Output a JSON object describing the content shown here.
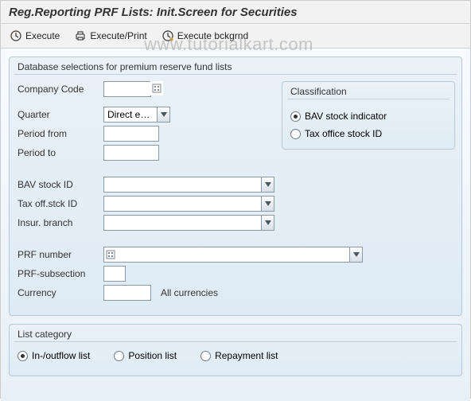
{
  "watermark": "www.tutorialkart.com",
  "header": {
    "title": "Reg.Reporting PRF Lists: Init.Screen for Securities"
  },
  "toolbar": {
    "exec": "Execute",
    "exec_print": "Execute/Print",
    "exec_bg": "Execute bckgrnd"
  },
  "panel1": {
    "title": "Database selections for premium reserve fund lists",
    "company_code_label": "Company Code",
    "company_code_value": "",
    "quarter_label": "Quarter",
    "quarter_value": "Direct en…",
    "period_from_label": "Period from",
    "period_from_value": "",
    "period_to_label": "Period to",
    "period_to_value": "",
    "bav_stock_id_label": "BAV stock ID",
    "bav_stock_id_value": "",
    "tax_off_label": "Tax off.stck ID",
    "tax_off_value": "",
    "insur_branch_label": "Insur. branch",
    "insur_branch_value": "",
    "prf_number_label": "PRF number",
    "prf_number_value": "",
    "prf_sub_label": "PRF-subsection",
    "prf_sub_value": "",
    "currency_label": "Currency",
    "currency_value": "",
    "all_currencies": "All currencies",
    "classification": {
      "title": "Classification",
      "opt1": "BAV stock indicator",
      "opt2": "Tax office stock ID",
      "selected": "opt1"
    }
  },
  "panel2": {
    "title": "List category",
    "opt1": "In-/outflow list",
    "opt2": "Position list",
    "opt3": "Repayment list",
    "selected": "opt1"
  }
}
